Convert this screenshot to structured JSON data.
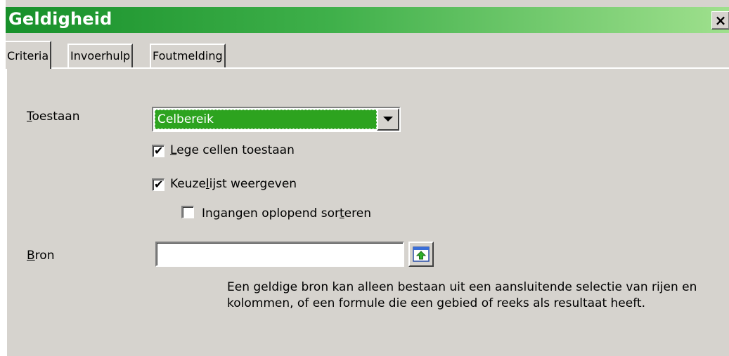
{
  "window": {
    "title": "Geldigheid",
    "close_glyph": "×"
  },
  "tabs": [
    {
      "label": "Criteria",
      "active": true
    },
    {
      "label": "Invoerhulp",
      "active": false
    },
    {
      "label": "Foutmelding",
      "active": false
    }
  ],
  "criteria": {
    "allow_label": {
      "mnemonic": "T",
      "rest": "oestaan"
    },
    "allow_value": "Celbereik",
    "allow_empty": {
      "pre": "",
      "mnemonic": "L",
      "post": "ege cellen toestaan",
      "checked": true
    },
    "show_list": {
      "pre": "Keuze",
      "mnemonic": "l",
      "post": "ijst weergeven",
      "checked": true
    },
    "sort_entries": {
      "pre": "Ingangen oplopend sor",
      "mnemonic": "t",
      "post": "eren",
      "checked": false
    },
    "source_label": {
      "mnemonic": "B",
      "rest": "ron"
    },
    "source_value": "",
    "shrink_icon": "shrink-window-icon",
    "help_text": "Een geldige bron kan alleen bestaan uit een aansluitende selectie van rijen en kolommen, of een formule die een gebied of reeks als resultaat heeft."
  },
  "colors": {
    "title_gradient_start": "#17902a",
    "title_gradient_end": "#9fe08d",
    "dialog_background": "#d6d3ce",
    "selection_green": "#2da31f"
  }
}
